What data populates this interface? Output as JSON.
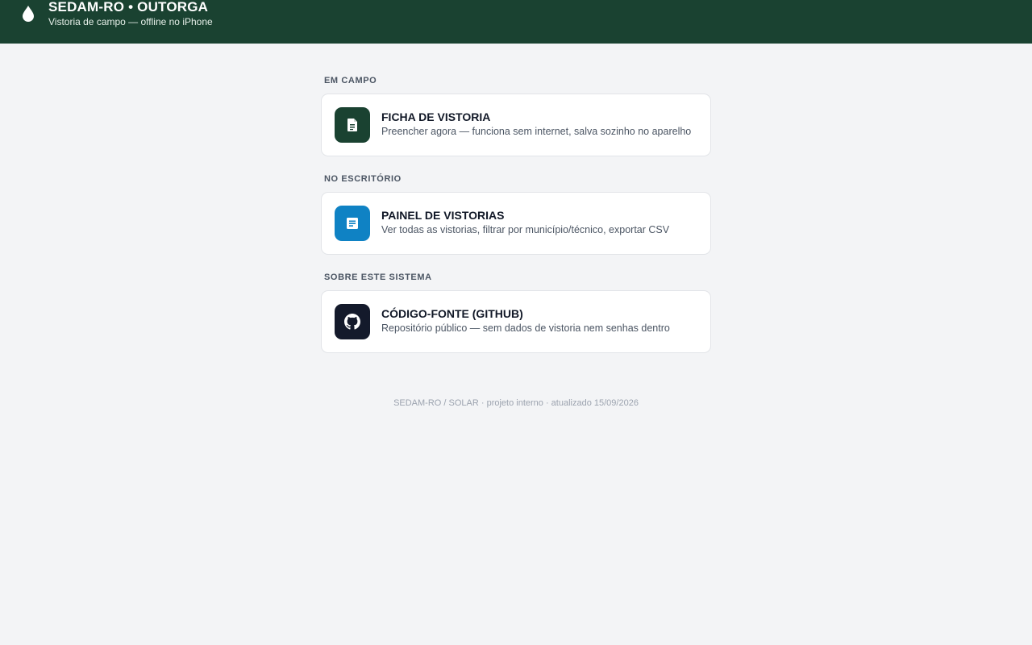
{
  "header": {
    "title": "SEDAM-RO • OUTORGA",
    "subtitle": "Vistoria de campo — offline no iPhone",
    "icon": "water-drop-icon"
  },
  "sections": [
    {
      "label": "EM CAMPO",
      "card": {
        "title": "FICHA DE VISTORIA",
        "description": "Preencher agora — funciona sem internet, salva sozinho no aparelho",
        "icon": "document-icon",
        "icon_bg": "#1a4231"
      }
    },
    {
      "label": "NO ESCRITÓRIO",
      "card": {
        "title": "PAINEL DE VISTORIAS",
        "description": "Ver todas as vistorias, filtrar por município/técnico, exportar CSV",
        "icon": "report-icon",
        "icon_bg": "#0f82c4"
      }
    },
    {
      "label": "SOBRE ESTE SISTEMA",
      "card": {
        "title": "CÓDIGO-FONTE (GITHUB)",
        "description": "Repositório público — sem dados de vistoria nem senhas dentro",
        "icon": "github-icon",
        "icon_bg": "#141a2b"
      }
    }
  ],
  "footer": {
    "text": "SEDAM-RO / SOLAR · projeto interno · atualizado 15/09/2026"
  },
  "colors": {
    "header_bg": "#1a4231",
    "page_bg": "#f3f4f6"
  }
}
